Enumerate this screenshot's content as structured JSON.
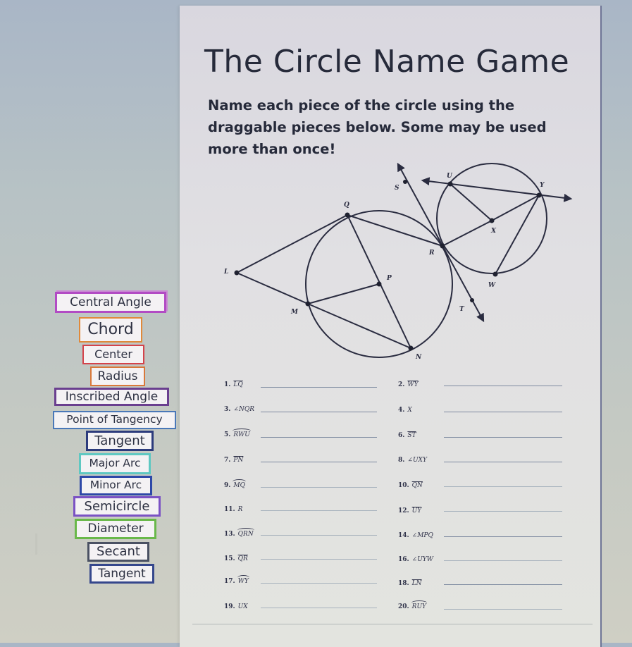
{
  "header": {
    "title": "The Circle Name Game",
    "instructions": "Name each piece of the circle using the draggable pieces below. Some may be used more than once!"
  },
  "diagram": {
    "points": [
      "L",
      "Q",
      "M",
      "N",
      "P",
      "R",
      "S",
      "T",
      "U",
      "X",
      "Y",
      "W"
    ]
  },
  "draggables": [
    {
      "label": "Central Angle",
      "color": "#b24bc4"
    },
    {
      "label": "Chord",
      "color": "#e0893a"
    },
    {
      "label": "Center",
      "color": "#d4434b"
    },
    {
      "label": "Radius",
      "color": "#d9783a"
    },
    {
      "label": "Inscribed Angle",
      "color": "#6a3f8f"
    },
    {
      "label": "Point of Tangency",
      "color": "#4a78b8"
    },
    {
      "label": "Tangent",
      "color": "#2c3b7c"
    },
    {
      "label": "Major Arc",
      "color": "#5fc8c2"
    },
    {
      "label": "Minor Arc",
      "color": "#2d48a8"
    },
    {
      "label": "Semicircle",
      "color": "#7b52c4"
    },
    {
      "label": "Diameter",
      "color": "#69b84a"
    },
    {
      "label": "Secant",
      "color": "#4a5163"
    },
    {
      "label": "Tangent",
      "color": "#35478c"
    }
  ],
  "questions": [
    {
      "num": "1.",
      "symbol": "LQ",
      "notation": "overline",
      "answer": ""
    },
    {
      "num": "2.",
      "symbol": "WY",
      "notation": "overline",
      "answer": ""
    },
    {
      "num": "3.",
      "symbol": "∠NQR",
      "notation": "none",
      "answer": ""
    },
    {
      "num": "4.",
      "symbol": "X",
      "notation": "none",
      "answer": ""
    },
    {
      "num": "5.",
      "symbol": "RWU",
      "notation": "arc",
      "answer": ""
    },
    {
      "num": "6.",
      "symbol": "ST",
      "notation": "overline",
      "answer": ""
    },
    {
      "num": "7.",
      "symbol": "PN",
      "notation": "overline",
      "answer": ""
    },
    {
      "num": "8.",
      "symbol": "∠UXY",
      "notation": "none",
      "answer": ""
    },
    {
      "num": "9.",
      "symbol": "MQ",
      "notation": "arc",
      "answer": ""
    },
    {
      "num": "10.",
      "symbol": "QN",
      "notation": "overline",
      "answer": ""
    },
    {
      "num": "11.",
      "symbol": "R",
      "notation": "none",
      "answer": ""
    },
    {
      "num": "12.",
      "symbol": "UY",
      "notation": "overline",
      "answer": ""
    },
    {
      "num": "13.",
      "symbol": "QRN",
      "notation": "arc",
      "answer": ""
    },
    {
      "num": "14.",
      "symbol": "∠MPQ",
      "notation": "none",
      "answer": ""
    },
    {
      "num": "15.",
      "symbol": "QR",
      "notation": "overline",
      "answer": ""
    },
    {
      "num": "16.",
      "symbol": "∠UYW",
      "notation": "none",
      "answer": ""
    },
    {
      "num": "17.",
      "symbol": "WY",
      "notation": "arc",
      "answer": ""
    },
    {
      "num": "18.",
      "symbol": "LN",
      "notation": "overline",
      "answer": ""
    },
    {
      "num": "19.",
      "symbol": "UX",
      "notation": "none",
      "answer": ""
    },
    {
      "num": "20.",
      "symbol": "RUY",
      "notation": "arc",
      "answer": ""
    }
  ]
}
